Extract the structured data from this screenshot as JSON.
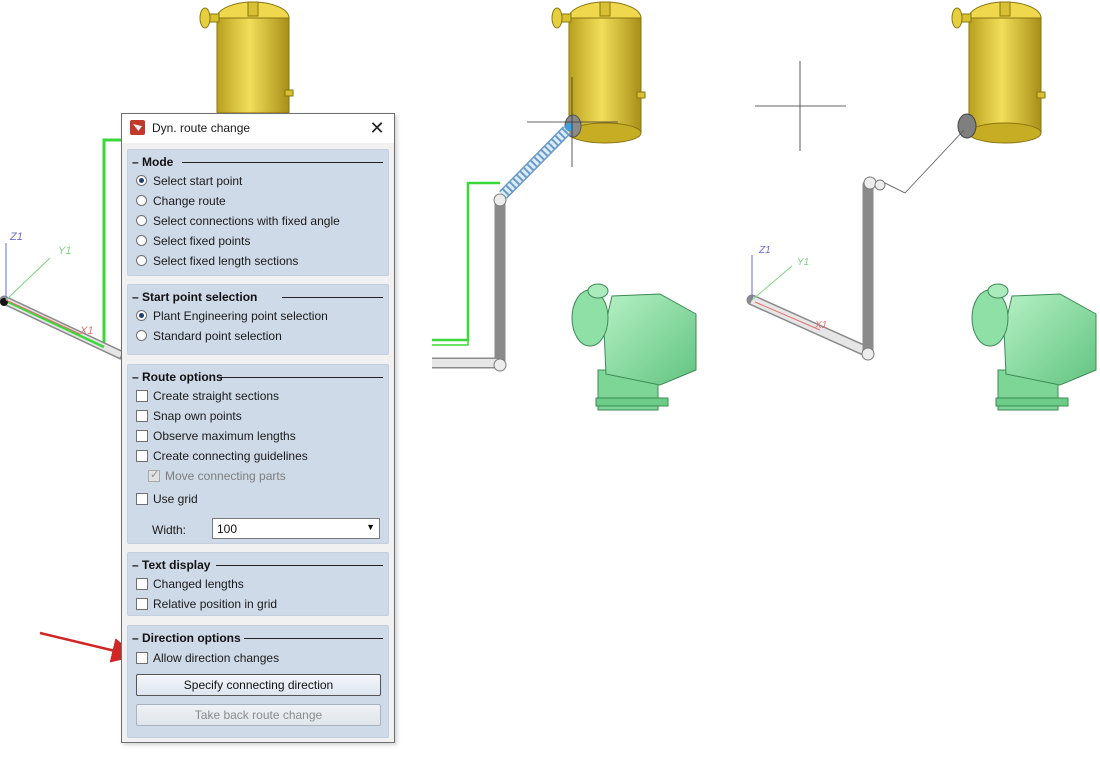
{
  "dialog": {
    "title": "Dyn. route change",
    "close_glyph": "✕",
    "mode": {
      "title": "Mode",
      "options": [
        "Select start point",
        "Change route",
        "Select connections with fixed angle",
        "Select fixed points",
        "Select fixed length sections"
      ],
      "selected": 0
    },
    "start_point": {
      "title": "Start point selection",
      "options": [
        "Plant Engineering point selection",
        "Standard point selection"
      ],
      "selected": 0
    },
    "route_options": {
      "title": "Route options",
      "create_straight": "Create straight sections",
      "snap_own": "Snap own points",
      "observe_max": "Observe maximum lengths",
      "create_guidelines": "Create connecting guidelines",
      "move_parts": "Move connecting parts",
      "use_grid": "Use grid",
      "width_label": "Width:",
      "width_value": "100"
    },
    "text_display": {
      "title": "Text display",
      "changed_lengths": "Changed lengths",
      "relative_position": "Relative position in grid"
    },
    "direction": {
      "title": "Direction options",
      "allow_changes": "Allow direction changes",
      "specify_button": "Specify connecting direction",
      "take_back_button": "Take back route change"
    },
    "collapse_glyph": "–",
    "dropdown_glyph": "▼"
  },
  "scene": {
    "axis_labels": {
      "left": {
        "z": "Z1",
        "y": "Y1",
        "x": "X1"
      },
      "right": {
        "z": "Z1",
        "y": "Y1",
        "x": "X1"
      }
    },
    "colors": {
      "tank": "#e2cc3e",
      "tank_dark": "#b39a1a",
      "pump": "#8fe0a6",
      "pump_dark": "#5cb878",
      "pipe": "#d8d8d8",
      "pipe_outline": "#8a8a8a",
      "route_green": "#3bd83b",
      "axis_blue": "#6a6ad8",
      "axis_green": "#7ad67a",
      "axis_red": "#e07070",
      "arrow_red": "#d22626"
    }
  }
}
